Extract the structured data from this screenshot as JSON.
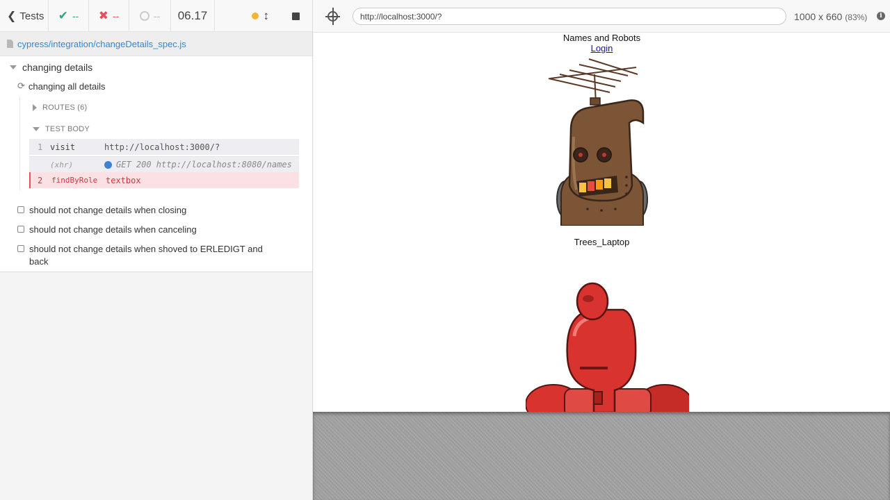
{
  "reporter": {
    "tests_label": "Tests",
    "stats": {
      "passed": "--",
      "failed": "--",
      "pending": "--"
    },
    "duration": "06.17",
    "spec_path": "cypress/integration/changeDetails_spec.js",
    "suite_title": "changing details",
    "active_test": "changing all details",
    "routes_label": "ROUTES (6)",
    "test_body_label": "TEST BODY",
    "commands": [
      {
        "num": "1",
        "name": "visit",
        "message": "http://localhost:3000/?"
      },
      {
        "num": "",
        "name": "(xhr)",
        "message": "GET 200 http://localhost:8080/names"
      },
      {
        "num": "2",
        "name": "findByRole",
        "message": "textbox"
      }
    ],
    "pending_tests": [
      "should not change details when closing",
      "should not change details when canceling",
      "should not change details when shoved to ERLEDIGT and back"
    ]
  },
  "aut": {
    "url": "http://localhost:3000/?",
    "viewport": "1000 x 660",
    "scale": "(83%)",
    "app": {
      "title": "Names and Robots",
      "login_link": "Login",
      "robots": [
        {
          "name": "Trees_Laptop",
          "color": "#7b5536"
        },
        {
          "name": "",
          "color": "#d8332f"
        }
      ]
    }
  },
  "colors": {
    "pass": "#2aa876",
    "fail": "#e94f5a",
    "running_dot": "#f5b437",
    "link": "#3386d4",
    "xhr_dot": "#3b82d1"
  },
  "icons": [
    "chevron-left-icon",
    "check-icon",
    "x-icon",
    "pending-circle-icon",
    "running-dot-icon",
    "scroll-toggle-icon",
    "stop-icon",
    "file-icon",
    "caret-down-icon",
    "caret-right-icon",
    "refresh-spinner-icon",
    "selector-playground-icon",
    "info-icon",
    "checkbox-icon"
  ]
}
